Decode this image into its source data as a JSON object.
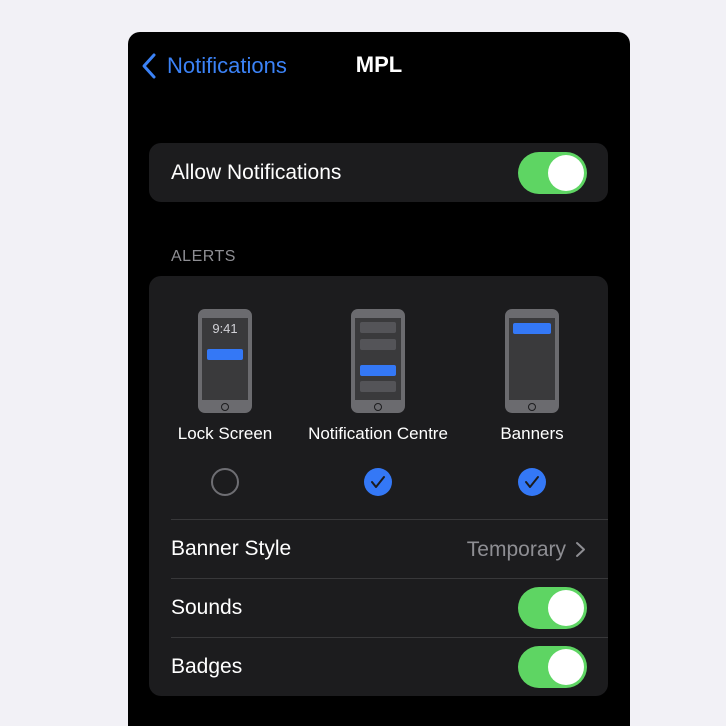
{
  "nav": {
    "back_label": "Notifications",
    "title": "MPL"
  },
  "allow_notifications": {
    "label": "Allow Notifications",
    "on": true
  },
  "alerts": {
    "header": "ALERTS",
    "options": [
      {
        "label": "Lock Screen",
        "selected": false,
        "time": "9:41"
      },
      {
        "label": "Notification Centre",
        "selected": true
      },
      {
        "label": "Banners",
        "selected": true
      }
    ]
  },
  "banner_style": {
    "label": "Banner Style",
    "value": "Temporary"
  },
  "sounds": {
    "label": "Sounds",
    "on": true
  },
  "badges": {
    "label": "Badges",
    "on": true
  },
  "colors": {
    "accent": "#3478f6",
    "toggle_on": "#5ed563",
    "background": "#000000",
    "cell": "#1c1c1e"
  }
}
